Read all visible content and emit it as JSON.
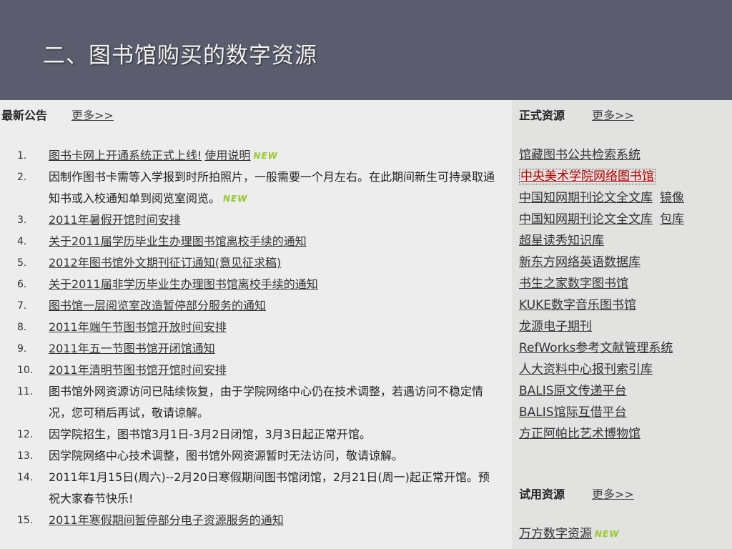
{
  "slide": {
    "title": "二、图书馆购买的数字资源"
  },
  "left": {
    "section_title": "最新公告",
    "more_label": "更多>>",
    "notices": [
      {
        "num": "1.",
        "text": "图书卡网上开通系统正式上线!",
        "link_text": "使用说明",
        "new": "NEW"
      },
      {
        "num": "2.",
        "text": "因制作图书卡需等入学报到时所拍照片，一般需要一个月左右。在此期间新生可持录取通知书或入校通知单到阅览室阅览。",
        "new": "NEW"
      },
      {
        "num": "3.",
        "text": "2011年暑假开馆时间安排"
      },
      {
        "num": "4.",
        "text": "关于2011届学历毕业生办理图书馆离校手续的通知"
      },
      {
        "num": "5.",
        "text": "2012年图书馆外文期刊征订通知(意见征求稿)"
      },
      {
        "num": "6.",
        "text": "关于2011届非学历毕业生办理图书馆离校手续的通知"
      },
      {
        "num": "7.",
        "text": "图书馆一层阅览室改造暂停部分服务的通知"
      },
      {
        "num": "8.",
        "text": "2011年端午节图书馆开放时间安排"
      },
      {
        "num": "9.",
        "text": "2011年五一节图书馆开闭馆通知"
      },
      {
        "num": "10.",
        "text": "2011年清明节图书馆开馆时间安排"
      },
      {
        "num": "11.",
        "text": "图书馆外网资源访问已陆续恢复，由于学院网络中心仍在技术调整，若遇访问不稳定情况，您可稍后再试，敬请谅解。"
      },
      {
        "num": "12.",
        "text": "因学院招生，图书馆3月1日-3月2日闭馆，3月3日起正常开馆。"
      },
      {
        "num": "13.",
        "text": "因学院网络中心技术调整，图书馆外网资源暂时无法访问，敬请谅解。"
      },
      {
        "num": "14.",
        "text": "2011年1月15日(周六)--2月20日寒假期间图书馆闭馆，2月21日(周一)起正常开馆。预祝大家春节快乐!"
      },
      {
        "num": "15.",
        "text": "2011年寒假期间暂停部分电子资源服务的通知"
      }
    ]
  },
  "right": {
    "formal_title": "正式资源",
    "formal_more": "更多>>",
    "formal_items": [
      {
        "label": "馆藏图书公共检索系统"
      },
      {
        "label": "中央美术学院网络图书馆"
      },
      {
        "label": "中国知网期刊论文全文库",
        "extra": "镜像"
      },
      {
        "label": "中国知网期刊论文全文库",
        "extra": "包库"
      },
      {
        "label": "超星读秀知识库"
      },
      {
        "label": "新东方网络英语数据库"
      },
      {
        "label": "书生之家数字图书馆"
      },
      {
        "label": "KUKE数字音乐图书馆"
      },
      {
        "label": "龙源电子期刊"
      },
      {
        "label": "RefWorks参考文献管理系统"
      },
      {
        "label": "人大资料中心报刊索引库"
      },
      {
        "label": "BALIS原文传递平台"
      },
      {
        "label": "BALIS馆际互借平台"
      },
      {
        "label": "方正阿帕比艺术博物馆"
      }
    ],
    "trial_title": "试用资源",
    "trial_more": "更多>>",
    "trial_items": [
      {
        "label": "万方数字资源",
        "new": "NEW"
      }
    ]
  }
}
